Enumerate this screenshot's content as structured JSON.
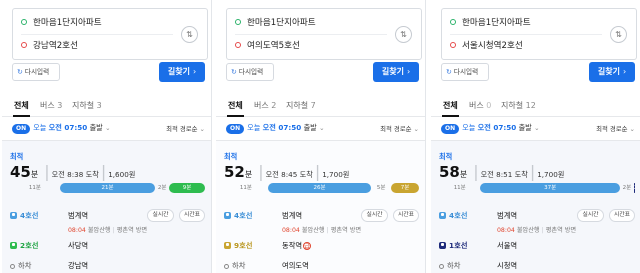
{
  "panels": [
    {
      "start": "한마음1단지아파트",
      "end": "강남역2호선",
      "reset_label": "다시입력",
      "search_label": "길찾기",
      "tabs": [
        {
          "label": "전체",
          "count": ""
        },
        {
          "label": "버스",
          "count": "3"
        },
        {
          "label": "지하철",
          "count": "3"
        }
      ],
      "on_badge": "ON",
      "on_today": "오늘",
      "on_time": "오전 07:50",
      "on_depart": "출발",
      "sort": "최적 경로순",
      "fastest": "최적",
      "duration_num": "45",
      "duration_unit": "분",
      "arrival": "오전 8:38 도착",
      "fare": "1,600원",
      "segments": [
        {
          "label": "11분",
          "minutes": 11,
          "line": "walk"
        },
        {
          "label": "21분",
          "minutes": 21,
          "line": "4"
        },
        {
          "label": "2분",
          "minutes": 2,
          "line": "walk"
        },
        {
          "label": "9분",
          "minutes": 9,
          "line": "2"
        }
      ],
      "board1_line": "4호선",
      "board1_station": "범계역",
      "board1_sub_time": "08:04",
      "board1_sub_dir": "불암산행",
      "board1_sub_dest": "평촌역 방면",
      "realtime_label": "실시간",
      "timetable_label": "시간표",
      "board2_line": "2호선",
      "board2_station": "사당역",
      "alight_label": "하차",
      "alight_station": "강남역"
    },
    {
      "start": "한마음1단지아파트",
      "end": "여의도역5호선",
      "reset_label": "다시입력",
      "search_label": "길찾기",
      "tabs": [
        {
          "label": "전체",
          "count": ""
        },
        {
          "label": "버스",
          "count": "2"
        },
        {
          "label": "지하철",
          "count": "7"
        }
      ],
      "on_badge": "ON",
      "on_today": "오늘",
      "on_time": "오전 07:50",
      "on_depart": "출발",
      "sort": "최적 경로순",
      "fastest": "최적",
      "duration_num": "52",
      "duration_unit": "분",
      "arrival": "오전 8:45 도착",
      "fare": "1,700원",
      "segments": [
        {
          "label": "11분",
          "minutes": 11,
          "line": "walk"
        },
        {
          "label": "26분",
          "minutes": 26,
          "line": "4"
        },
        {
          "label": "5분",
          "minutes": 5,
          "line": "walk"
        },
        {
          "label": "7분",
          "minutes": 7,
          "line": "9"
        }
      ],
      "board1_line": "4호선",
      "board1_station": "범계역",
      "board1_sub_time": "08:04",
      "board1_sub_dir": "불암산행",
      "board1_sub_dest": "평촌역 방면",
      "realtime_label": "실시간",
      "timetable_label": "시간표",
      "board2_line": "9호선",
      "board2_station": "동작역",
      "board2_badge": "급",
      "alight_label": "하차",
      "alight_station": "여의도역"
    },
    {
      "start": "한마음1단지아파트",
      "end": "서울시청역2호선",
      "reset_label": "다시입력",
      "search_label": "길찾기",
      "tabs": [
        {
          "label": "전체",
          "count": ""
        },
        {
          "label": "버스",
          "count": "0"
        },
        {
          "label": "지하철",
          "count": "12"
        }
      ],
      "on_badge": "ON",
      "on_today": "오늘",
      "on_time": "오전 07:50",
      "on_depart": "출발",
      "sort": "최적 경로순",
      "fastest": "최적",
      "duration_num": "58",
      "duration_unit": "분",
      "arrival": "오전 8:51 도착",
      "fare": "1,700원",
      "segments": [
        {
          "label": "11분",
          "minutes": 11,
          "line": "walk"
        },
        {
          "label": "37분",
          "minutes": 37,
          "line": "4"
        },
        {
          "label": "2분",
          "minutes": 2,
          "line": "walk"
        },
        {
          "label": "2분",
          "minutes": 2,
          "line": "1"
        }
      ],
      "board1_line": "4호선",
      "board1_station": "범계역",
      "board1_sub_time": "08:04",
      "board1_sub_dir": "불암산행",
      "board1_sub_dest": "평촌역 방면",
      "realtime_label": "실시간",
      "timetable_label": "시간표",
      "board2_line": "1호선",
      "board2_station": "서울역",
      "alight_label": "하차",
      "alight_station": "시청역"
    }
  ],
  "colors": {
    "primary": "#1a6fe8",
    "line_4": "#4a9ee0",
    "line_2": "#2ebc4f",
    "line_9": "#c9a531",
    "line_1": "#1d2a7a",
    "start_dot": "#2cb36b",
    "end_dot": "#e64a4a"
  },
  "icons": {
    "swap": "swap-vertical-icon",
    "reset": "refresh-icon",
    "search_arrow": "chevron-right-icon",
    "subway": "subway-icon",
    "walk": "walk-icon"
  }
}
